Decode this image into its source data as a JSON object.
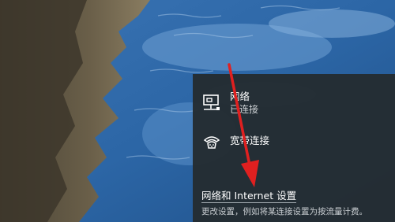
{
  "network_flyout": {
    "connections": [
      {
        "icon": "ethernet-network-icon",
        "name": "网络",
        "status": "已连接"
      },
      {
        "icon": "dialup-broadband-icon",
        "name": "宽带连接"
      }
    ],
    "settings_link": "网络和 Internet 设置",
    "settings_description": "更改设置，例如将某连接设置为按流量计费。"
  },
  "colors": {
    "flyout_background": "#242c32",
    "annotation_arrow": "#e02020"
  }
}
